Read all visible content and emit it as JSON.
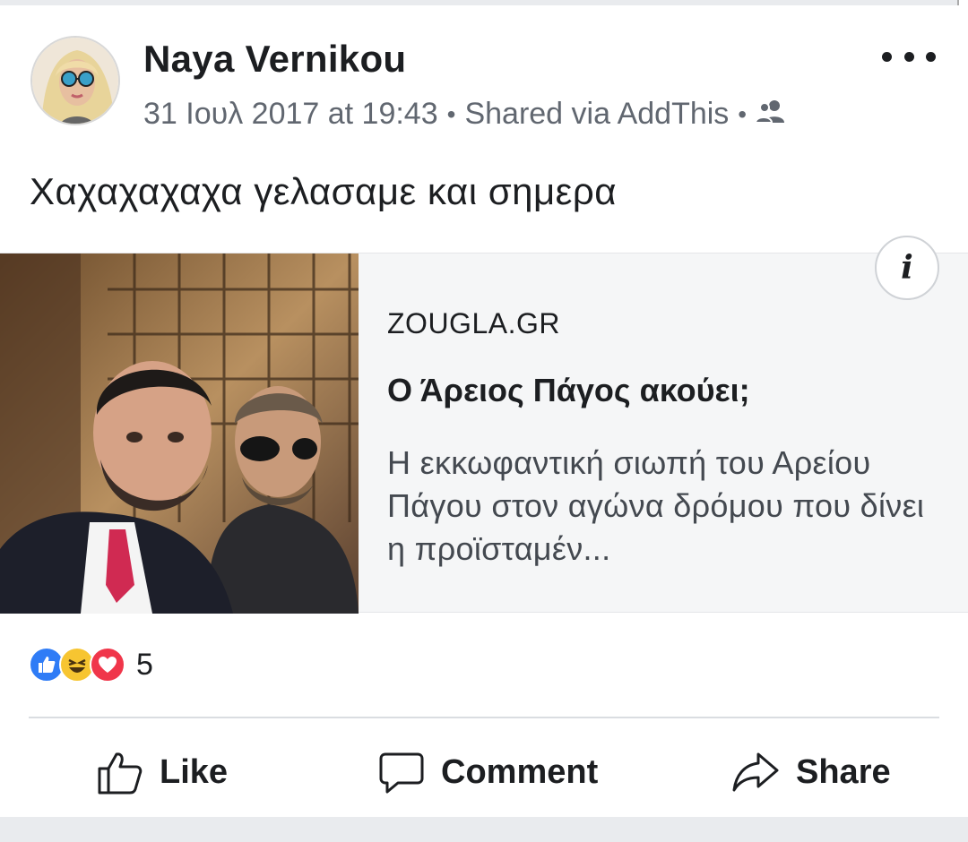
{
  "post": {
    "author": "Naya Vernikou",
    "timestamp": "31 Ιουλ 2017 at 19:43",
    "separator": "•",
    "shared_via": "Shared via AddThis",
    "audience_icon": "friends-icon",
    "more_icon": "more-options-icon",
    "status_text": "Χαχαχαχαχα γελασαμε και σημερα"
  },
  "link_preview": {
    "domain": "ZOUGLA.GR",
    "headline": "Ο Άρειος Πάγος ακούει;",
    "description": "Η εκκωφαντική σιωπή του Αρείου Πάγου στον αγώνα δρόμου που δίνει η προϊσταμέν...",
    "info_label": "i"
  },
  "reactions": {
    "types": [
      "like-reaction-icon",
      "haha-reaction-icon",
      "love-reaction-icon"
    ],
    "count": "5"
  },
  "actions": {
    "like": "Like",
    "comment": "Comment",
    "share": "Share"
  },
  "colors": {
    "text": "#1c1e21",
    "meta": "#616770",
    "like_blue": "#2f7cf6",
    "haha_yellow": "#f7c531",
    "love_red": "#f0364a"
  }
}
